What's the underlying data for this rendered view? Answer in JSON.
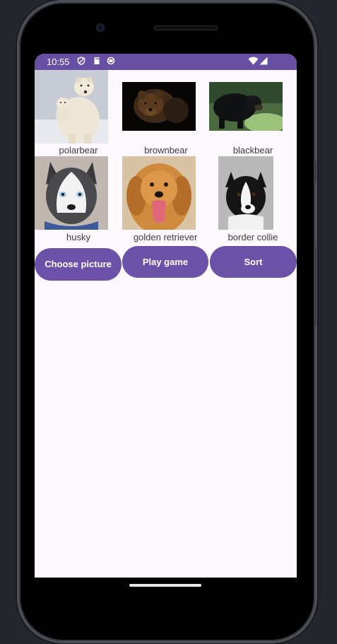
{
  "status_bar": {
    "time": "10:55",
    "icons": [
      "shield-icon",
      "sd-card-icon",
      "sync-icon",
      "wifi-icon",
      "signal-icon"
    ],
    "color": "#6750a4"
  },
  "grid": {
    "row1": [
      {
        "label": "polarbear",
        "image": "polar-bear-photo"
      },
      {
        "label": "brownbear",
        "image": "brown-bear-photo"
      },
      {
        "label": "blackbear",
        "image": "black-bear-photo"
      }
    ],
    "row2": [
      {
        "label": "husky",
        "image": "husky-photo"
      },
      {
        "label": "golden retriever",
        "image": "golden-retriever-photo"
      },
      {
        "label": "border collie",
        "image": "border-collie-photo"
      }
    ]
  },
  "buttons": {
    "choose_picture": "Choose picture",
    "play_game": "Play game",
    "sort": "Sort",
    "color": "#6b52a8"
  },
  "colors": {
    "screen_background": "#fdf7fe",
    "device_background": "#24252d"
  }
}
